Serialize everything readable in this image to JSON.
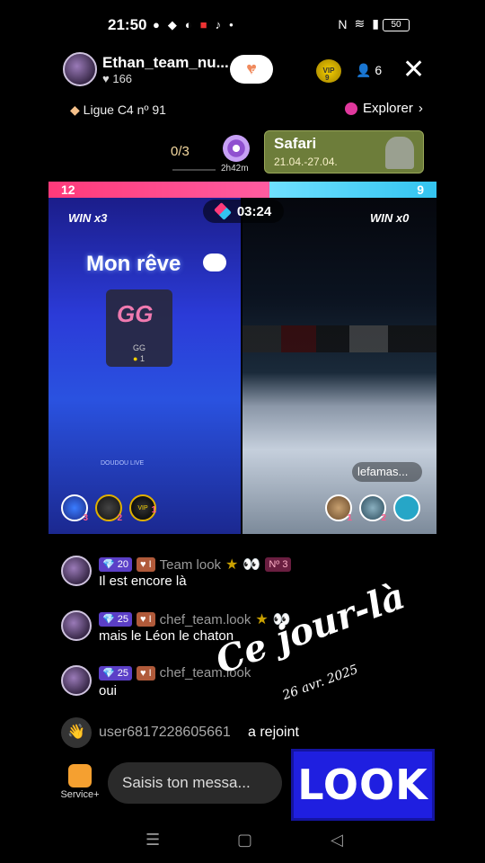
{
  "status_bar": {
    "time": "21:50",
    "battery": "50"
  },
  "header": {
    "host_name": "Ethan_team_nu...",
    "likes": "166",
    "heart_count": "5",
    "vip_label": "VIP",
    "vip_level": "9",
    "viewers": "6",
    "close_glyph": "✕"
  },
  "ligue": {
    "label": "Ligue C4 nº 91"
  },
  "explorer": {
    "label": "Explorer"
  },
  "rank_counter": {
    "value": "0/3",
    "timer": "2h42m"
  },
  "safari_card": {
    "title": "Safari",
    "dates": "21.04.-27.04."
  },
  "battle": {
    "left_score": "12",
    "right_score": "9",
    "left_win": "WIN x3",
    "right_win": "WIN x0",
    "timer": "03:24",
    "left_share": 0.57
  },
  "left_panel": {
    "caption": "Mon rêve",
    "gift_card": {
      "logo": "GG",
      "name": "GG",
      "count": "1"
    },
    "watermark": "DOUDOU LIVE",
    "avatars": [
      {
        "name": "avatar-a",
        "rank": "3"
      },
      {
        "name": "avatar-2",
        "rank": "2"
      },
      {
        "name": "avatar-vip",
        "rank": "1",
        "label": "VIP"
      }
    ]
  },
  "right_panel": {
    "username_pill": "lefamas...",
    "avatars": [
      {
        "name": "avatar-1",
        "rank": "1"
      },
      {
        "name": "avatar-2",
        "rank": "2"
      },
      {
        "name": "avatar-3",
        "rank": ""
      }
    ]
  },
  "chat": [
    {
      "diamond": "20",
      "heart": "I",
      "user": "Team look",
      "extra": "Nº 3",
      "text": "Il est encore là"
    },
    {
      "diamond": "25",
      "heart": "I",
      "user": "chef_team.look",
      "extra": "",
      "text": "mais le Léon le chaton"
    },
    {
      "diamond": "25",
      "heart": "I",
      "user": "chef_team.look",
      "extra": "",
      "text": "oui"
    }
  ],
  "joined": {
    "user": "user6817228605661",
    "text": "a rejoint"
  },
  "overlay": {
    "title": "Ce jour-là",
    "date": "26 avr. 2025"
  },
  "bottom": {
    "service_label": "Service+",
    "input_placeholder": "Saisis ton messa...",
    "logo_text": "LOOK"
  },
  "colors": {
    "battle_left": "#ff3a7a",
    "battle_right": "#33c4f0",
    "diamond_badge": "#5b3fc7",
    "logo_bg": "#1f1fe0"
  },
  "icons": [
    "search-icon",
    "heart-icon",
    "vip-icon",
    "person-icon",
    "close-icon",
    "diamond-icon",
    "explorer-icon",
    "target-icon",
    "battle-icon",
    "cloud-icon",
    "wave-icon",
    "service-icon",
    "menu-icon",
    "home-icon",
    "back-icon"
  ]
}
